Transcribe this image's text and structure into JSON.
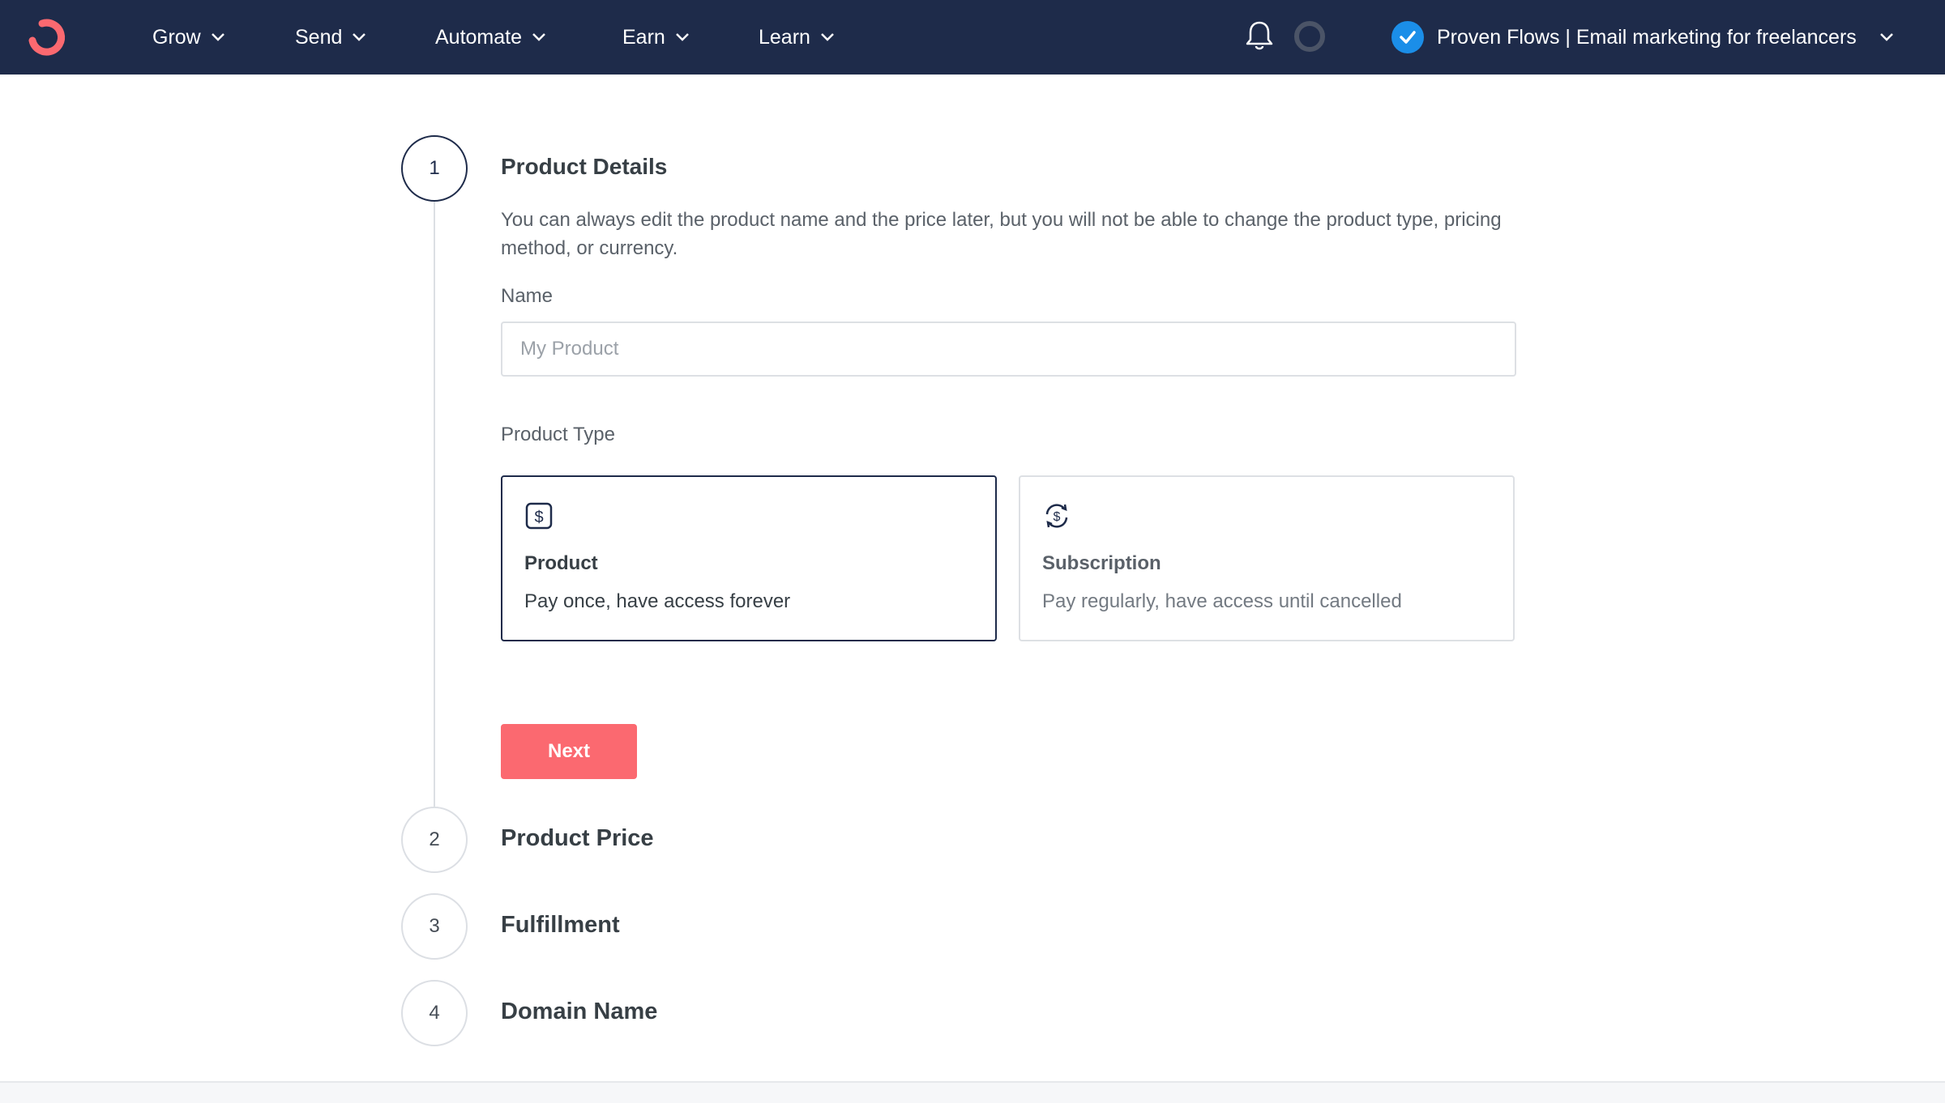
{
  "nav": {
    "items": [
      {
        "label": "Grow"
      },
      {
        "label": "Send"
      },
      {
        "label": "Automate"
      },
      {
        "label": "Earn"
      },
      {
        "label": "Learn"
      }
    ],
    "account_name": "Proven Flows | Email marketing for freelancers",
    "icons": {
      "logo": "convertkit-logo",
      "bell": "bell-icon",
      "status": "status-ring-icon",
      "verified": "check-badge-icon"
    },
    "colors": {
      "bar": "#1e2b4a",
      "logo": "#fb6970",
      "verified": "#1b8ee8"
    }
  },
  "steps": [
    {
      "number": "1",
      "title": "Product Details",
      "active": true
    },
    {
      "number": "2",
      "title": "Product Price",
      "active": false
    },
    {
      "number": "3",
      "title": "Fulfillment",
      "active": false
    },
    {
      "number": "4",
      "title": "Domain Name",
      "active": false
    }
  ],
  "details": {
    "description": "You can always edit the product name and the price later, but you will not be able to change the product type, pricing method, or currency.",
    "name_label": "Name",
    "name_placeholder": "My Product",
    "name_value": "",
    "type_label": "Product Type",
    "types": [
      {
        "title": "Product",
        "subtitle": "Pay once, have access forever",
        "icon": "dollar-square-icon",
        "selected": true
      },
      {
        "title": "Subscription",
        "subtitle": "Pay regularly, have access until cancelled",
        "icon": "recurring-dollar-icon",
        "selected": false
      }
    ],
    "next_label": "Next",
    "accent": "#fb6970"
  }
}
